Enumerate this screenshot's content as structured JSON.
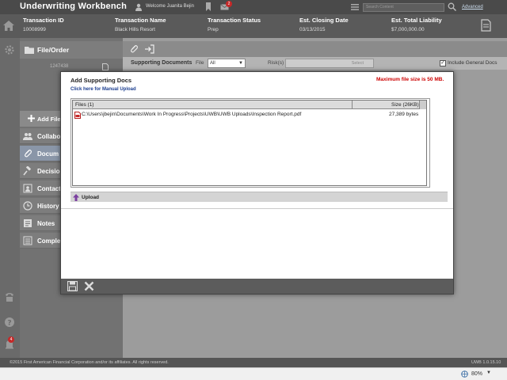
{
  "app": {
    "title": "Underwriting Workbench",
    "welcome": "Welcome Juanita Bejin",
    "mail_count": "2",
    "search_placeholder": "Search Content",
    "advanced_label": "Advanced"
  },
  "transaction": {
    "columns": [
      {
        "label": "Transaction ID",
        "value": "10008999"
      },
      {
        "label": "Transaction Name",
        "value": "Black Hills Resort"
      },
      {
        "label": "Transaction Status",
        "value": "Prep"
      },
      {
        "label": "Est. Closing Date",
        "value": "03/13/2015"
      },
      {
        "label": "Est. Total Liability",
        "value": "$7,000,000.00"
      }
    ]
  },
  "sidebar": {
    "header": "File/Order",
    "order_number": "1247438",
    "add_file": "Add File",
    "items": [
      {
        "label": "Collabo",
        "icon": "people-icon",
        "active": false
      },
      {
        "label": "Docum",
        "icon": "paperclip-icon",
        "active": true
      },
      {
        "label": "Decisio",
        "icon": "gavel-icon",
        "active": false
      },
      {
        "label": "Contact",
        "icon": "contact-icon",
        "active": false
      },
      {
        "label": "History",
        "icon": "clock-icon",
        "active": false
      },
      {
        "label": "Notes",
        "icon": "notes-icon",
        "active": false
      },
      {
        "label": "Comple",
        "icon": "checklist-icon",
        "active": false
      }
    ]
  },
  "rail": {
    "notification_count": "4"
  },
  "filterbar": {
    "title": "Supporting Documents",
    "file_label": "File",
    "file_value": "All",
    "risk_label": "Risk(s)",
    "risk_placeholder": "Select",
    "include_general_label": "Include General Docs",
    "include_general_checked": true
  },
  "modal": {
    "title": "Add Supporting Docs",
    "max_size": "Maximum file size is 50 MB.",
    "manual_upload_link": "Click here for Manual Upload",
    "files_header": "Files (1)",
    "size_header": "Size (26KB)",
    "files": [
      {
        "path": "C:\\Users\\jbejin\\Documents\\Work In Progress\\Projects\\UWB\\UWB Uploads\\Inspection Report.pdf",
        "size": "27,389 bytes"
      }
    ],
    "upload_label": "Upload"
  },
  "footer": {
    "copyright": "©2015 First American Financial Corporation and/or its affiliates. All rights reserved.",
    "version": "UWB 1.0.15.10"
  },
  "browser": {
    "zoom": "80%"
  }
}
